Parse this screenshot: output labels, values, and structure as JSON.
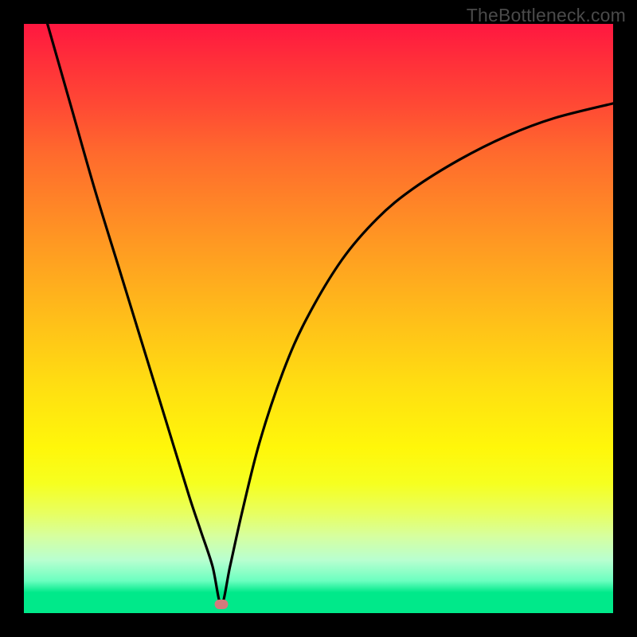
{
  "watermark": "TheBottleneck.com",
  "colors": {
    "frame": "#000000",
    "curve": "#000000",
    "marker": "#d47a7c"
  },
  "chart_data": {
    "type": "line",
    "title": "",
    "xlabel": "",
    "ylabel": "",
    "xlim": [
      0,
      100
    ],
    "ylim": [
      0,
      100
    ],
    "grid": false,
    "legend": false,
    "minimum_point": {
      "x": 33.5,
      "y": 1.5
    },
    "series": [
      {
        "name": "bottleneck-curve",
        "x": [
          4,
          8,
          12,
          16,
          20,
          24,
          28,
          30,
          32,
          33.5,
          35,
          37,
          40,
          44,
          48,
          54,
          60,
          66,
          74,
          82,
          90,
          100
        ],
        "y": [
          100,
          86,
          72,
          59,
          46,
          33,
          20,
          14,
          8,
          1.5,
          8,
          17,
          29,
          41,
          50,
          60,
          67,
          72,
          77,
          81,
          84,
          86.5
        ]
      }
    ]
  }
}
